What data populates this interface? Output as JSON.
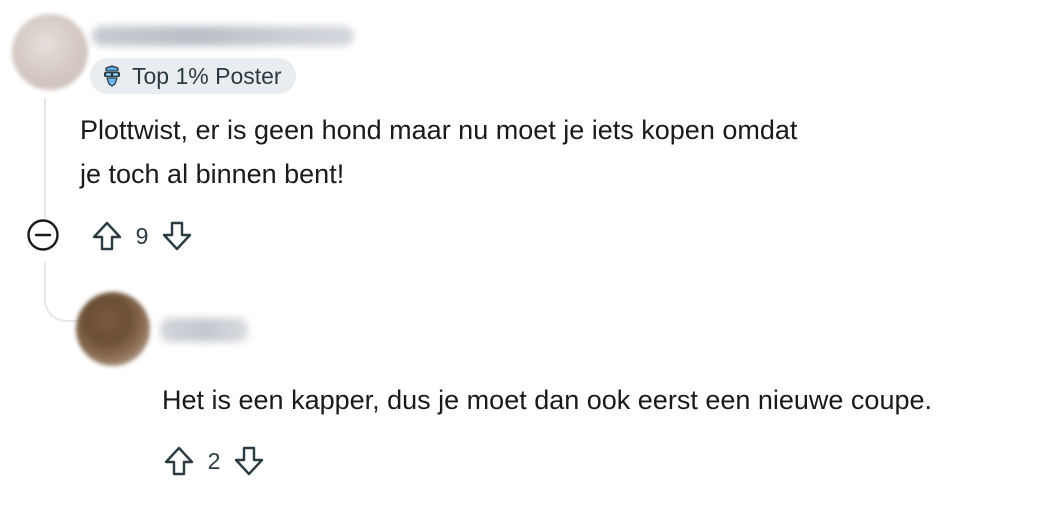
{
  "comment": {
    "author_hidden": true,
    "flair": {
      "icon": "top-poster-badge-icon",
      "label": "Top 1% Poster"
    },
    "body_lines": [
      "Plottwist, er is geen hond maar nu moet je iets kopen omdat",
      "je toch al binnen bent!"
    ],
    "score": "9",
    "collapse_icon": "collapse-minus-icon"
  },
  "reply": {
    "author_hidden": true,
    "body": "Het is een kapper, dus je moet dan ook eerst een nieuwe coupe.",
    "score": "2"
  },
  "colors": {
    "text": "#1a1a1b",
    "meta": "#2a3c42",
    "flair_bg": "#eaedf0",
    "thread_line": "#e5e7ea",
    "badge_blue": "#4a90d9"
  }
}
